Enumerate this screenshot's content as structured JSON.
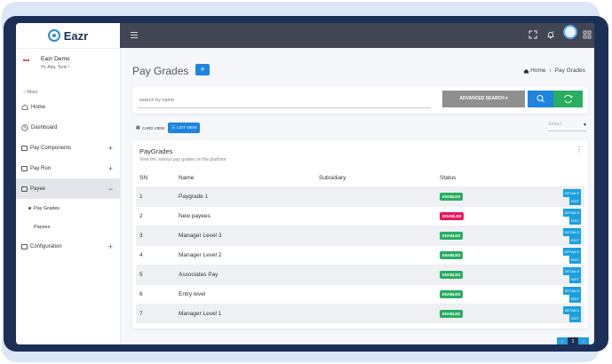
{
  "app": {
    "name": "Eazr"
  },
  "profile": {
    "org": "Eazr Demo",
    "greeting": "Hi, Ada, Tomi !"
  },
  "sidebar": {
    "section_label": "Main",
    "items": [
      {
        "label": "Home"
      },
      {
        "label": "Dashboard"
      },
      {
        "label": "Pay Components",
        "sign": "+"
      },
      {
        "label": "Pay Run",
        "sign": "+"
      },
      {
        "label": "Payee",
        "sign": "−"
      },
      {
        "label": "Pay Grades"
      },
      {
        "label": "Payees"
      },
      {
        "label": "Configuration",
        "sign": "+"
      }
    ]
  },
  "page": {
    "title": "Pay Grades",
    "add_label": "+"
  },
  "breadcrumb": {
    "home": "Home",
    "sep": "›",
    "current": "Pay Grades"
  },
  "search": {
    "placeholder": "search by name",
    "advanced_label": "ADVANCED SEARCH ▾"
  },
  "views": {
    "card": "CARD VIEW",
    "list": "LIST VIEW"
  },
  "select": {
    "placeholder": "Select"
  },
  "table": {
    "title": "PayGrades",
    "subtitle": "View the various pay grades on the platform",
    "columns": [
      "SN",
      "Name",
      "Subsidiary",
      "Status",
      ""
    ],
    "rows": [
      {
        "sn": "1",
        "name": "Paygrade 1",
        "subsidiary": "",
        "status": "ENABLED"
      },
      {
        "sn": "2",
        "name": "New payees",
        "subsidiary": "",
        "status": "DISABLED"
      },
      {
        "sn": "3",
        "name": "Manager Level 3",
        "subsidiary": "",
        "status": "ENABLED"
      },
      {
        "sn": "4",
        "name": "Manager Level 2",
        "subsidiary": "",
        "status": "ENABLED"
      },
      {
        "sn": "5",
        "name": "Associates Pay",
        "subsidiary": "",
        "status": "ENABLED"
      },
      {
        "sn": "6",
        "name": "Entry level",
        "subsidiary": "",
        "status": "ENABLED"
      },
      {
        "sn": "7",
        "name": "Manager Level 1",
        "subsidiary": "",
        "status": "ENABLED"
      }
    ],
    "details_label": "DETAILS",
    "edit_label": "EDIT"
  },
  "pagination": {
    "prev": "‹",
    "current": "1",
    "next": "›"
  },
  "colors": {
    "navy": "#1c3057",
    "blue": "#1f84e0",
    "green": "#27ae60",
    "pink": "#e8175d",
    "topbar": "#424653"
  }
}
